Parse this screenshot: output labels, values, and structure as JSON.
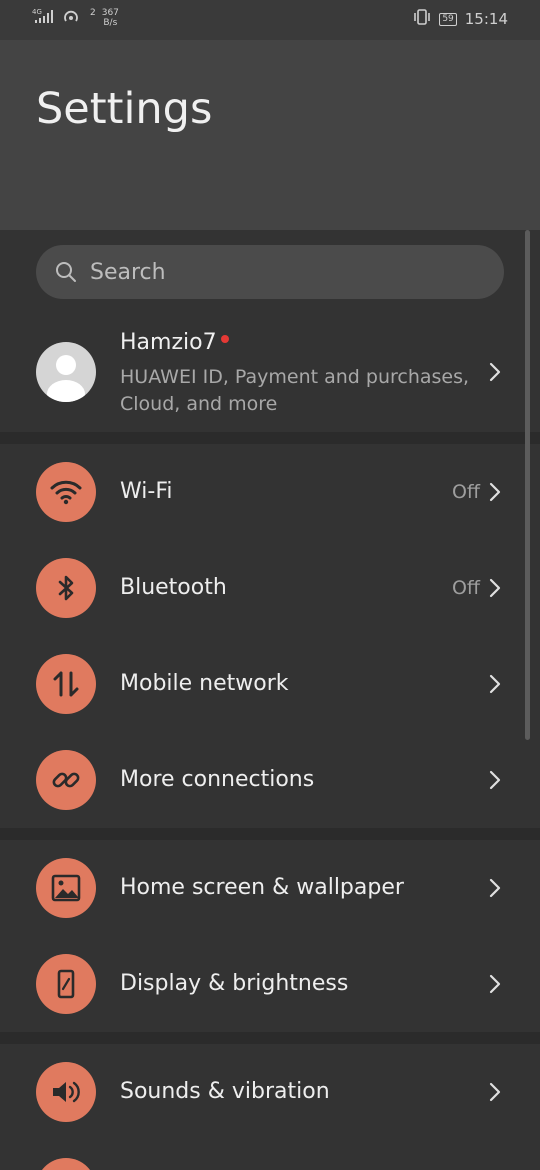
{
  "status_bar": {
    "network": "4G",
    "sim_badge": "2",
    "speed_value": "367",
    "speed_unit": "B/s",
    "battery": "59",
    "time": "15:14"
  },
  "page_title": "Settings",
  "search": {
    "placeholder": "Search"
  },
  "account": {
    "name": "Hamzio7",
    "subtitle": "HUAWEI ID, Payment and purchases, Cloud, and more"
  },
  "connectivity": [
    {
      "label": "Wi-Fi",
      "value": "Off",
      "icon": "wifi-icon"
    },
    {
      "label": "Bluetooth",
      "value": "Off",
      "icon": "bluetooth-icon"
    },
    {
      "label": "Mobile network",
      "value": "",
      "icon": "mobile-network-icon"
    },
    {
      "label": "More connections",
      "value": "",
      "icon": "link-icon"
    }
  ],
  "display_group": [
    {
      "label": "Home screen & wallpaper",
      "icon": "wallpaper-icon"
    },
    {
      "label": "Display & brightness",
      "icon": "display-icon"
    }
  ],
  "sound_group": [
    {
      "label": "Sounds & vibration",
      "icon": "speaker-icon"
    }
  ],
  "colors": {
    "accent": "#e07a5f",
    "background": "#333333",
    "header": "#444444"
  }
}
